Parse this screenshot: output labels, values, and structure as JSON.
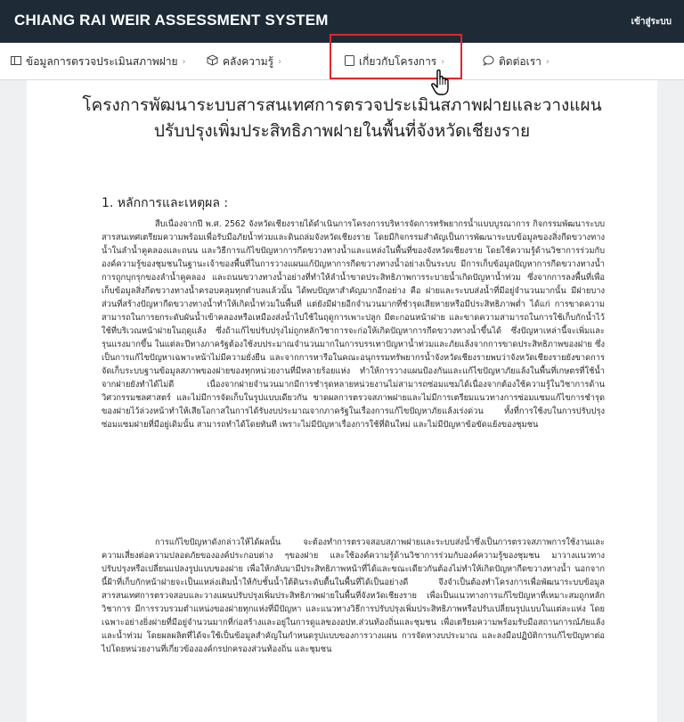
{
  "header": {
    "app_title": "CHIANG RAI WEIR ASSESSMENT SYSTEM",
    "login_label": "เข้าสู่ระบบ"
  },
  "nav": {
    "items": [
      {
        "label": "ข้อมูลการตรวจประเมินสภาพฝาย",
        "icon": "table-icon"
      },
      {
        "label": "คลังความรู้",
        "icon": "cube-icon"
      },
      {
        "label": "เกี่ยวกับโครงการ",
        "icon": "document-icon"
      },
      {
        "label": "ติดต่อเรา",
        "icon": "chat-bubble-icon"
      }
    ],
    "highlighted_index": 2,
    "highlight_color": "#e0262b"
  },
  "main": {
    "title_line1": "โครงการพัฒนาระบบสารสนเทศการตรวจประเมินสภาพฝายและวางแผน",
    "title_line2": "ปรับปรุงเพิ่มประสิทธิภาพฝายในพื้นที่จังหวัดเชียงราย",
    "section_heading": "1. หลักการและเหตุผล :",
    "paragraph1": "สืบเนื่องจากปี พ.ศ. 2562 จังหวัดเชียงรายได้ดำเนินการโครงการบริหารจัดการทรัพยากรน้ำแบบบูรณาการ กิจกรรมพัฒนาระบบสารสนเทศเตรียมความพร้อมเพื่อรับมือภัยน้ำท่วมและดินถล่มจังหวัดเชียงราย โดยมีกิจกรรมสำคัญเป็นการพัฒนาระบบข้อมูลของสิ่งกีดขวางทางน้ำในลำน้ำคูคลองและถนน และวิธีการแก้ไขปัญหาการกีดขวางทางน้ำและแหล่งในพื้นที่ของจังหวัดเชียงราย โดยใช้ความรู้ด้านวิชาการร่วมกับองค์ความรู้ของชุมชนในฐานะเจ้าของพื้นที่ในการวางแผนแก้ปัญหาการกีดขวางทางน้ำอย่างเป็นระบบ มีการเก็บข้อมูลปัญหาการกีดขวางทางน้ำ การถูกบุกรุกของลำน้ำคูคลอง และถนนขวางทางน้ำอย่างที่ทำให้ลำน้ำขาดประสิทธิภาพการระบายน้ำเกิดปัญหาน้ำท่วม ซึ่งจากการลงพื้นที่เพื่อเก็บข้อมูลสิ่งกีดขวางทางน้ำครอบคลุมทุกตำบลแล้วนั้น ได้พบปัญหาสำคัญมากอีกอย่าง คือ ฝายและระบบส่งน้ำที่มีอยู่จำนวนมากนั้น มีฝายบางส่วนที่สร้างปัญหากีดขวางทางน้ำทำให้เกิดน้ำท่วมในพื้นที่ แต่ยังมีฝายอีกจำนวนมากที่ชำรุดเสียหายหรือมีประสิทธิภาพต่ำ ได้แก่ การขาดความสามารถในการยกระดับผันน้ำเข้าคลองหรือเหมืองส่งน้ำไปใช้ในฤดูการเพาะปลูก มีตะกอนหน้าฝาย และขาดความสามารถในการใช้เก็บกักน้ำไว้ใช้ที่บริเวณหน้าฝายในฤดูแล้ง ซึ่งถ้าแก้ไขปรับปรุงไม่ถูกหลักวิชาการจะก่อให้เกิดปัญหาการกีดขวางทางน้ำขึ้นได้ ซึ่งปัญหาเหล่านี้จะเพิ่มและรุนแรงมากขึ้น ในแต่ละปีทางภาครัฐต้องใช้งบประมาณจำนวนมากในการบรรเทาปัญหาน้ำท่วมและภัยแล้งจากการขาดประสิทธิภาพของฝาย ซึ่งเป็นการแก้ไขปัญหาเฉพาะหน้าไม่มีความยั่งยืน และจากการหารือในคณะอนุกรรมทรัพยากรน้ำจังหวัดเชียงรายพบว่าจังหวัดเชียงรายยังขาดการจัดเก็บระบบฐานข้อมูลสภาพของฝายของทุกหน่วยงานที่มีหลายร้อยแห่ง ทำให้การวางแผนป้องกันและแก้ไขปัญหาภัยแล้งในพื้นที่เกษตรที่ใช้น้ำจากฝายยังทำได้ไม่ดี เนื่องจากฝายจำนวนมากมีการชำรุดหลายหน่วยงานไม่สามารถซ่อมแซมได้เนื่องจากต้องใช้ความรู้ในวิชาการด้านวิศวกรรมชลศาสตร์ และไม่มีการจัดเก็บในรูปแบบเดียวกัน ขาดผลการตรวจสภาพฝายและไม่มีการเตรียมแนวทางการซ่อมแซมแก้ไขการชำรุดของฝายไว้ล่วงหน้าทำให้เสียโอกาสในการได้รับงบประมาณจากภาครัฐในเรื่องการแก้ไขปัญหาภัยแล้งเร่งด่วน ทั้งที่การใช้งบในการปรับปรุงซ่อมแซมฝายที่มีอยู่เดิมนั้น สามารถทำได้โดยทันที เพราะไม่มีปัญหาเรื่องการใช้ที่ดินใหม่ และไม่มีปัญหาข้อขัดแย้งของชุมชน",
    "paragraph2": "การแก้ไขปัญหาดังกล่าวให้ได้ผลนั้น จะต้องทำการตรวจสอบสภาพฝายและระบบส่งน้ำซึ่งเป็นการตรวจสภาพการใช้งานและความเสี่ยงต่อความปลอดภัยขององค์ประกอบต่าง ๆของฝาย และใช้องค์ความรู้ด้านวิชาการร่วมกับองค์ความรู้ของชุมชน มาวางแนวทางปรับปรุงหรือเปลี่ยนแปลงรูปแบบของฝาย เพื่อให้กลับมามีประสิทธิภาพหน้าที่ได้และขณะเดียวกันต้องไม่ทำให้เกิดปัญหากีดขวางทางน้ำ นอกจากนี้ฝ้าที่เก็บกักหน้าฝายจะเป็นแหล่งเติมน้ำให้กับชั้นน้ำใต้ดินระดับตื้นในพื้นที่ได้เป็นอย่างดี จึงจำเป็นต้องทำโครงการเพื่อพัฒนาระบบข้อมูลสารสนเทศการตรวจสอบและวางแผนปรับปรุงเพิ่มประสิทธิภาพฝายในพื้นที่จังหวัดเชียงราย เพื่อเป็นแนวทางการแก้ไขปัญหาที่เหมาะสมถูกหลักวิชาการ มีการรวบรวมตำแหน่งของฝายทุกแห่งที่มีปัญหา และแนวทางวิธีการปรับปรุงเพิ่มประสิทธิภาพหรือปรับเปลี่ยนรูปแบบในแต่ละแห่ง โดยเฉพาะอย่างยิ่งฝายที่มีอยู่จำนวนมากที่ก่อสร้างและอยู่ในการดูแลของอปท.ส่วนท้องถิ่นและชุมชน เพื่อเตรียมความพร้อมรับมือสถานการณ์ภัยแล้งและน้ำท่วม โดยผลผลิตที่ได้จะใช้เป็นข้อมูลสำคัญในกำหนดรูปแบบของการวางแผน การจัดหางบประมาณ และลงมือปฏิบัติการแก้ไขปัญหาต่อไปโดยหน่วยงานที่เกี่ยวข้ององค์กรปกครองส่วนท้องถิ่น และชุมชน"
  }
}
